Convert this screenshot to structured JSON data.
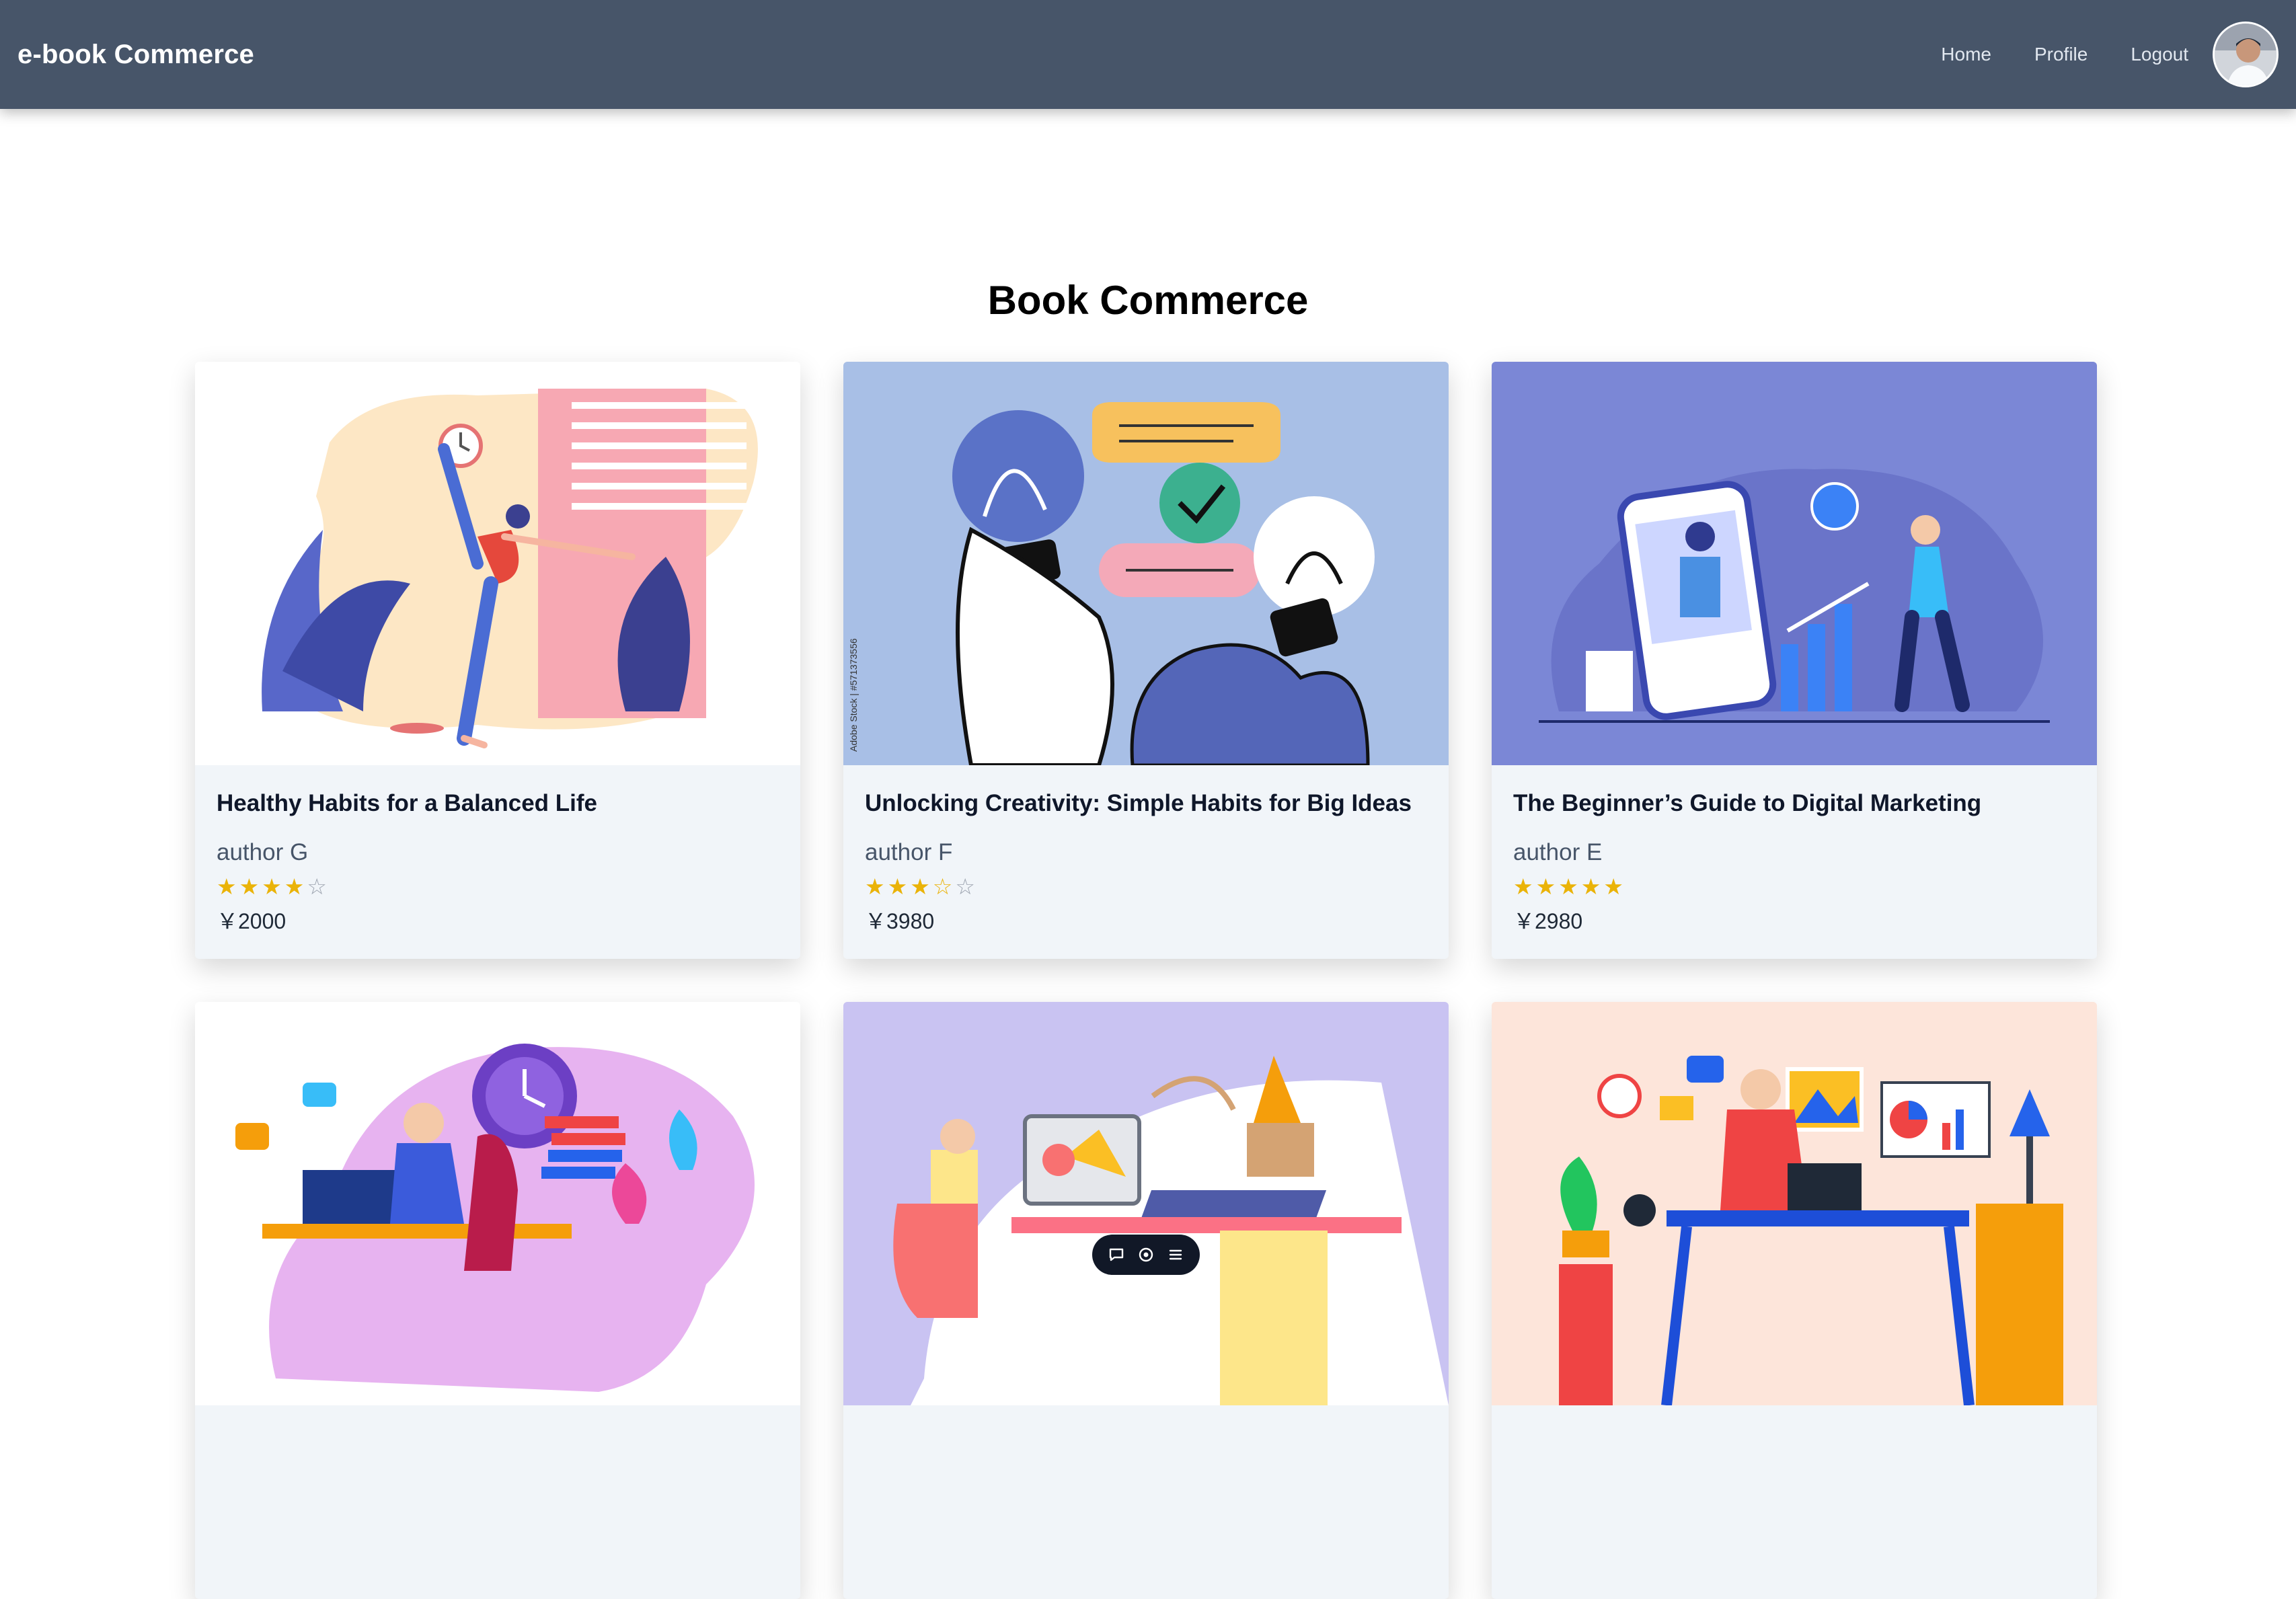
{
  "navbar": {
    "brand": "e-book Commerce",
    "links": [
      "Home",
      "Profile",
      "Logout"
    ],
    "avatar_icon": "user-avatar-photo"
  },
  "page": {
    "title": "Book Commerce"
  },
  "books": [
    {
      "title": "Healthy Habits for a Balanced Life",
      "author": "author G",
      "rating": 4,
      "max_rating": 5,
      "price": "￥2000",
      "illustration": "yoga-woman-illustration"
    },
    {
      "title": "Unlocking Creativity: Simple Habits for Big Ideas",
      "author": "author F",
      "rating": 3.5,
      "max_rating": 5,
      "price": "￥3980",
      "illustration": "lightbulb-hands-illustration",
      "watermark": "Adobe Stock | #571373556"
    },
    {
      "title": "The Beginner’s Guide to Digital Marketing",
      "author": "author E",
      "rating": 5,
      "max_rating": 5,
      "price": "￥2980",
      "illustration": "digital-marketing-phone-illustration"
    },
    {
      "title": "",
      "author": "",
      "rating": null,
      "price": "",
      "illustration": "man-working-laptop-illustration"
    },
    {
      "title": "",
      "author": "",
      "rating": null,
      "price": "",
      "illustration": "designer-desk-illustration"
    },
    {
      "title": "",
      "author": "",
      "rating": null,
      "price": "",
      "illustration": "man-home-office-illustration"
    }
  ],
  "colors": {
    "navbar_bg": "#475569",
    "card_bg": "#f1f5f9",
    "star": "#eab308"
  },
  "floating_toolbar": {
    "icons": [
      "chat-icon",
      "eye-icon",
      "menu-icon"
    ]
  }
}
